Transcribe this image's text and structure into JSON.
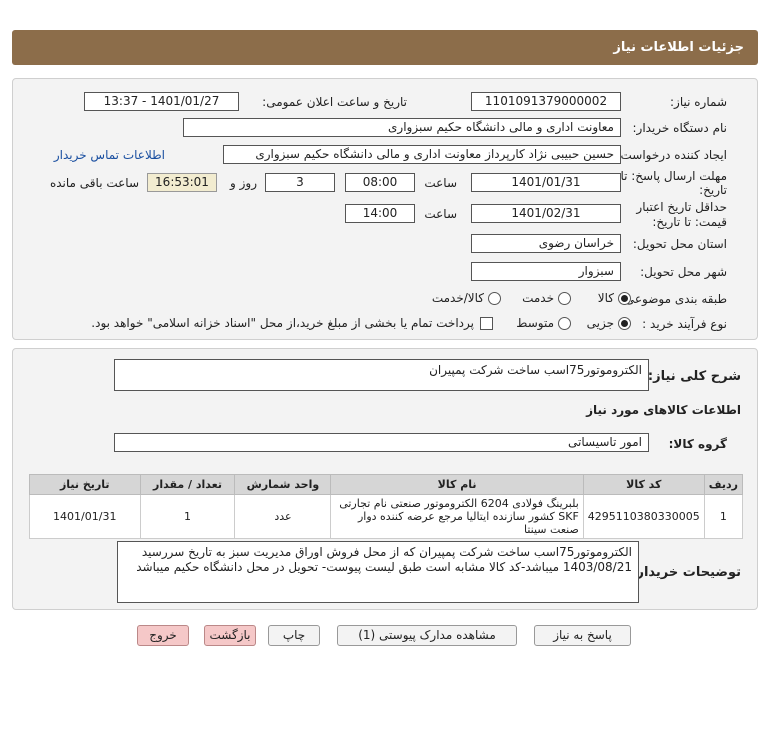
{
  "header": {
    "title": "جزئیات اطلاعات نیاز"
  },
  "form": {
    "need_number_label": "شماره نیاز:",
    "need_number": "1101091379000002",
    "announce_label": "تاریخ و ساعت اعلان عمومی:",
    "announce_value": "1401/01/27 - 13:37",
    "buyer_org_label": "نام دستگاه خریدار:",
    "buyer_org": "معاونت اداری و مالی دانشگاه حکیم سبزواری",
    "requester_label": "ایجاد کننده درخواست:",
    "requester": "حسین حبیبی نژاد کارپرداز معاونت اداری و مالی دانشگاه حکیم سبزواری",
    "contact_link": "اطلاعات تماس خریدار",
    "deadline_label_1": "مهلت ارسال پاسخ: تا",
    "deadline_label_2": "تاریخ:",
    "deadline_date": "1401/01/31",
    "time_label": "ساعت",
    "deadline_time": "08:00",
    "days_value": "3",
    "days_label": "روز و",
    "remaining_time": "16:53:01",
    "remaining_label": "ساعت باقی مانده",
    "validity_label_1": "حداقل تاریخ اعتبار",
    "validity_label_2": "قیمت: تا تاریخ:",
    "validity_date": "1401/02/31",
    "validity_time_label": "ساعت",
    "validity_time": "14:00",
    "province_label": "استان محل تحویل:",
    "province": "خراسان رضوی",
    "city_label": "شهر محل تحویل:",
    "city": "سبزوار",
    "category_label": "طبقه بندی موضوعی:",
    "category_options": [
      "کالا",
      "خدمت",
      "کالا/خدمت"
    ],
    "purchase_type_label": "نوع فرآیند خرید :",
    "purchase_options": [
      "جزیی",
      "متوسط"
    ],
    "payment_note": "پرداخت تمام یا بخشی از مبلغ خرید،از محل \"اسناد خزانه اسلامی\" خواهد بود."
  },
  "summary": {
    "label": "شرح کلی نیاز:",
    "value": "الکتروموتور75اسب ساخت  شرکت پمپیران",
    "goods_info_title": "اطلاعات کالاهای مورد نیاز",
    "group_label": "گروه کالا:",
    "group_value": "امور تاسیساتی"
  },
  "table": {
    "headers": [
      "ردیف",
      "کد کالا",
      "نام کالا",
      "واحد شمارش",
      "تعداد / مقدار",
      "تاریخ نیاز"
    ],
    "rows": [
      {
        "row": "1",
        "code": "4295110380330005",
        "name": "بلبرینگ فولادی 6204 الکتروموتور صنعتی نام تجارتی SKF کشور سازنده ایتالیا مرجع عرضه کننده دوار صنعت سینتا",
        "unit": "عدد",
        "qty": "1",
        "date": "1401/01/31"
      }
    ]
  },
  "buyer_notes": {
    "label": "توضیحات خریدار:",
    "text": "الکتروموتور75اسب ساخت  شرکت پمپیران که از محل فروش اوراق مدیریت سبز به تاریخ سررسید 1403/08/21 میباشد-کد کالا مشابه است طبق لیست پیوست- تحویل در محل دانشگاه حکیم میباشد"
  },
  "buttons": {
    "reply": "پاسخ به نیاز",
    "attachments": "مشاهده مدارک پیوستی (1)",
    "print": "چاپ",
    "back": "بازگشت",
    "exit": "خروج"
  }
}
